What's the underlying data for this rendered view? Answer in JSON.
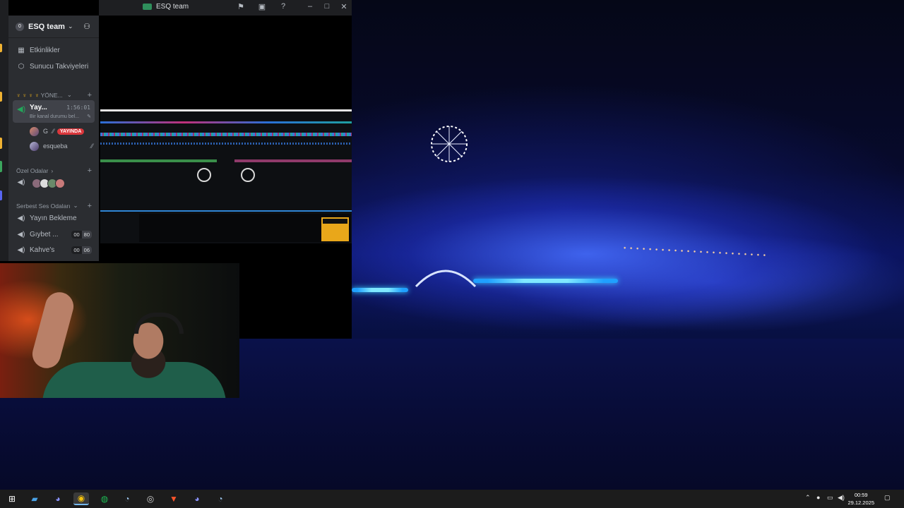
{
  "window": {
    "title": "ESQ team"
  },
  "titlebar_icons": [
    "flag-icon",
    "screen-icon",
    "help-icon",
    "minimize-icon",
    "maximize-icon",
    "close-icon"
  ],
  "server": {
    "badge": "0",
    "name": "ESQ team"
  },
  "sidebar": {
    "events_label": "Etkinlikler",
    "boosts_label": "Sunucu Takviyeleri",
    "category_manager": "YÖNE...",
    "active_channel": {
      "name": "Yay...",
      "timer": "1:56:01",
      "status": "Bir kanal durumu bel..."
    },
    "voice_users": [
      {
        "name": "G",
        "live_label": "YAYINDA"
      },
      {
        "name": "esqueba"
      }
    ],
    "private_rooms_label": "Özel Odalar",
    "free_voice_label": "Serbest Ses Odaları",
    "channels": [
      {
        "name": "Yayın Bekleme"
      },
      {
        "name": "Gıybet ...",
        "count_a": "00",
        "count_b": "80"
      },
      {
        "name": "Kahve's",
        "count_a": "00",
        "count_b": "06"
      }
    ]
  },
  "taskbar": {
    "apps": [
      "windows-start-icon",
      "file-explorer-icon",
      "discord-icon",
      "chrome-icon",
      "spotify-icon",
      "steam-icon",
      "obs-icon",
      "brave-icon",
      "discord-ptb-icon",
      "steam-alt-icon"
    ],
    "time": "00:59",
    "date": "29.12.2025"
  },
  "colors": {
    "online": "#23a55a",
    "live": "#da373c",
    "sidebar_bg": "#2b2d31",
    "stage_blue": "#3a5cff"
  }
}
